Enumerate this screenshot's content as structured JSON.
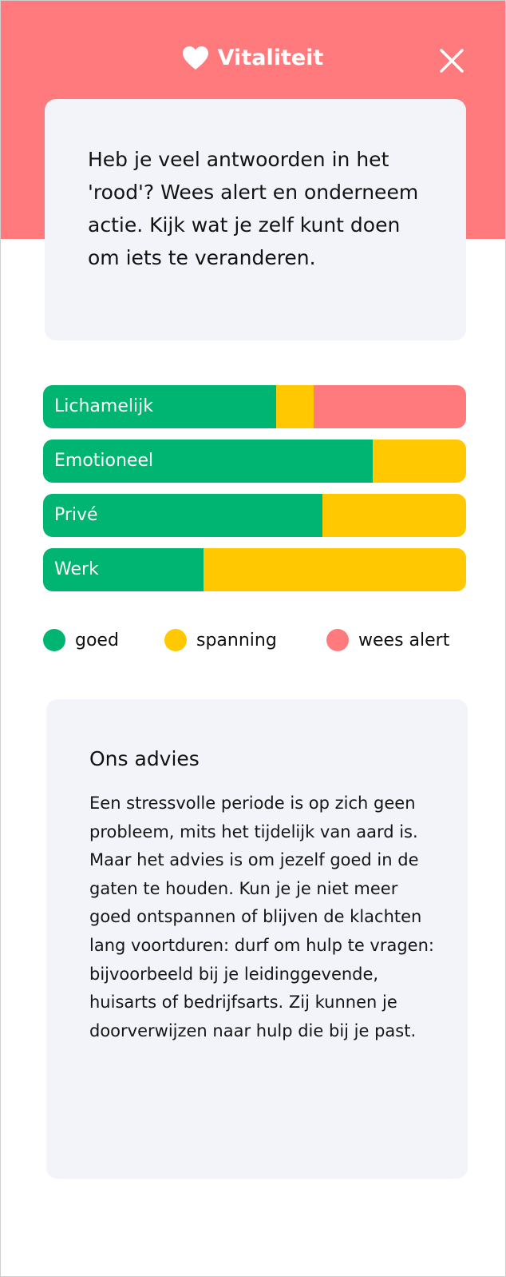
{
  "header": {
    "title": "Vitaliteit",
    "background_color": "#ff7a7c",
    "icon": "heart-icon",
    "close_icon": "close-icon"
  },
  "intro": {
    "text": "Heb je veel antwoorden in het 'rood'? Wees alert en onderneem actie. Kijk wat je zelf kunt doen om iets te veranderen."
  },
  "colors": {
    "goed": "#00b472",
    "spanning": "#ffc800",
    "wees_alert": "#ff7a7c"
  },
  "bars": [
    {
      "label": "Lichamelijk",
      "goed": 0.55,
      "spanning": 0.09,
      "wees_alert": 0.36
    },
    {
      "label": "Emotioneel",
      "goed": 0.78,
      "spanning": 0.22,
      "wees_alert": 0
    },
    {
      "label": "Privé",
      "goed": 0.66,
      "spanning": 0.34,
      "wees_alert": 0
    },
    {
      "label": "Werk",
      "goed": 0.38,
      "spanning": 0.62,
      "wees_alert": 0
    }
  ],
  "legend": {
    "goed": "goed",
    "spanning": "spanning",
    "wees_alert": "wees alert"
  },
  "advice": {
    "title": "Ons advies",
    "text": "Een stressvolle periode is op zich geen probleem, mits het tijdelijk van aard is. Maar het advies is om jezelf goed in de gaten te houden. Kun je je niet meer goed ontspannen of blijven de klachten lang voortduren: durf om hulp te vragen: bijvoorbeeld bij je leidinggevende, huisarts of bedrijfsarts. Zij kunnen je doorverwijzen naar hulp die bij je past."
  }
}
